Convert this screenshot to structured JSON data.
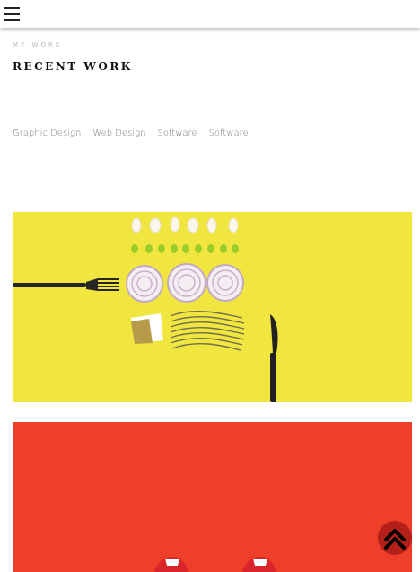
{
  "section": {
    "subtitle": "MY WORK",
    "title": "RECENT WORK"
  },
  "filters": [
    "Graphic Design",
    "Web Design",
    "Software",
    "Software"
  ],
  "cards": [
    {
      "image": "yellow-food-flatlay-photo",
      "accent": "#f1e63f"
    },
    {
      "image": "red-shoes-photo",
      "accent": "#ee3f2b"
    }
  ],
  "icons": {
    "menu": "hamburger-menu-icon",
    "back_to_top": "chevron-up-icon"
  },
  "colors": {
    "back_to_top": "#b3201a",
    "title": "#111111"
  }
}
